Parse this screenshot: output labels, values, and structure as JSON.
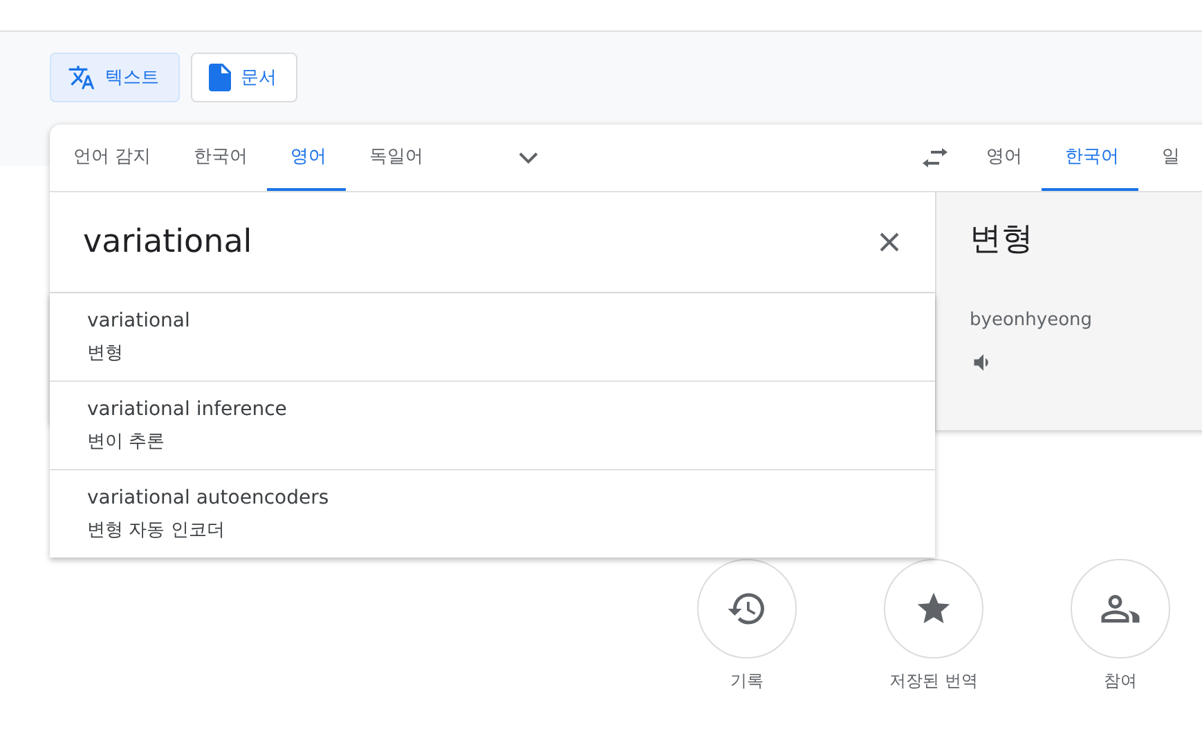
{
  "mode_buttons": [
    {
      "label": "텍스트",
      "kind": "text",
      "selected": true
    },
    {
      "label": "문서",
      "kind": "document",
      "selected": false
    }
  ],
  "source_languages": [
    {
      "label": "언어 감지",
      "selected": false
    },
    {
      "label": "한국어",
      "selected": false
    },
    {
      "label": "영어",
      "selected": true
    },
    {
      "label": "독일어",
      "selected": false
    }
  ],
  "target_languages": [
    {
      "label": "영어",
      "selected": false
    },
    {
      "label": "한국어",
      "selected": true
    },
    {
      "label": "일",
      "selected": false
    }
  ],
  "input": {
    "value": "variational"
  },
  "suggestions": [
    {
      "text": "variational",
      "translation": "변형"
    },
    {
      "text": "variational inference",
      "translation": "변이 추론"
    },
    {
      "text": "variational autoencoders",
      "translation": "변형 자동 인코더"
    }
  ],
  "translation": {
    "text": "변형",
    "romanization": "byeonhyeong"
  },
  "actions": [
    {
      "label": "기록",
      "kind": "history"
    },
    {
      "label": "저장된 번역",
      "kind": "saved"
    },
    {
      "label": "참여",
      "kind": "community"
    }
  ]
}
